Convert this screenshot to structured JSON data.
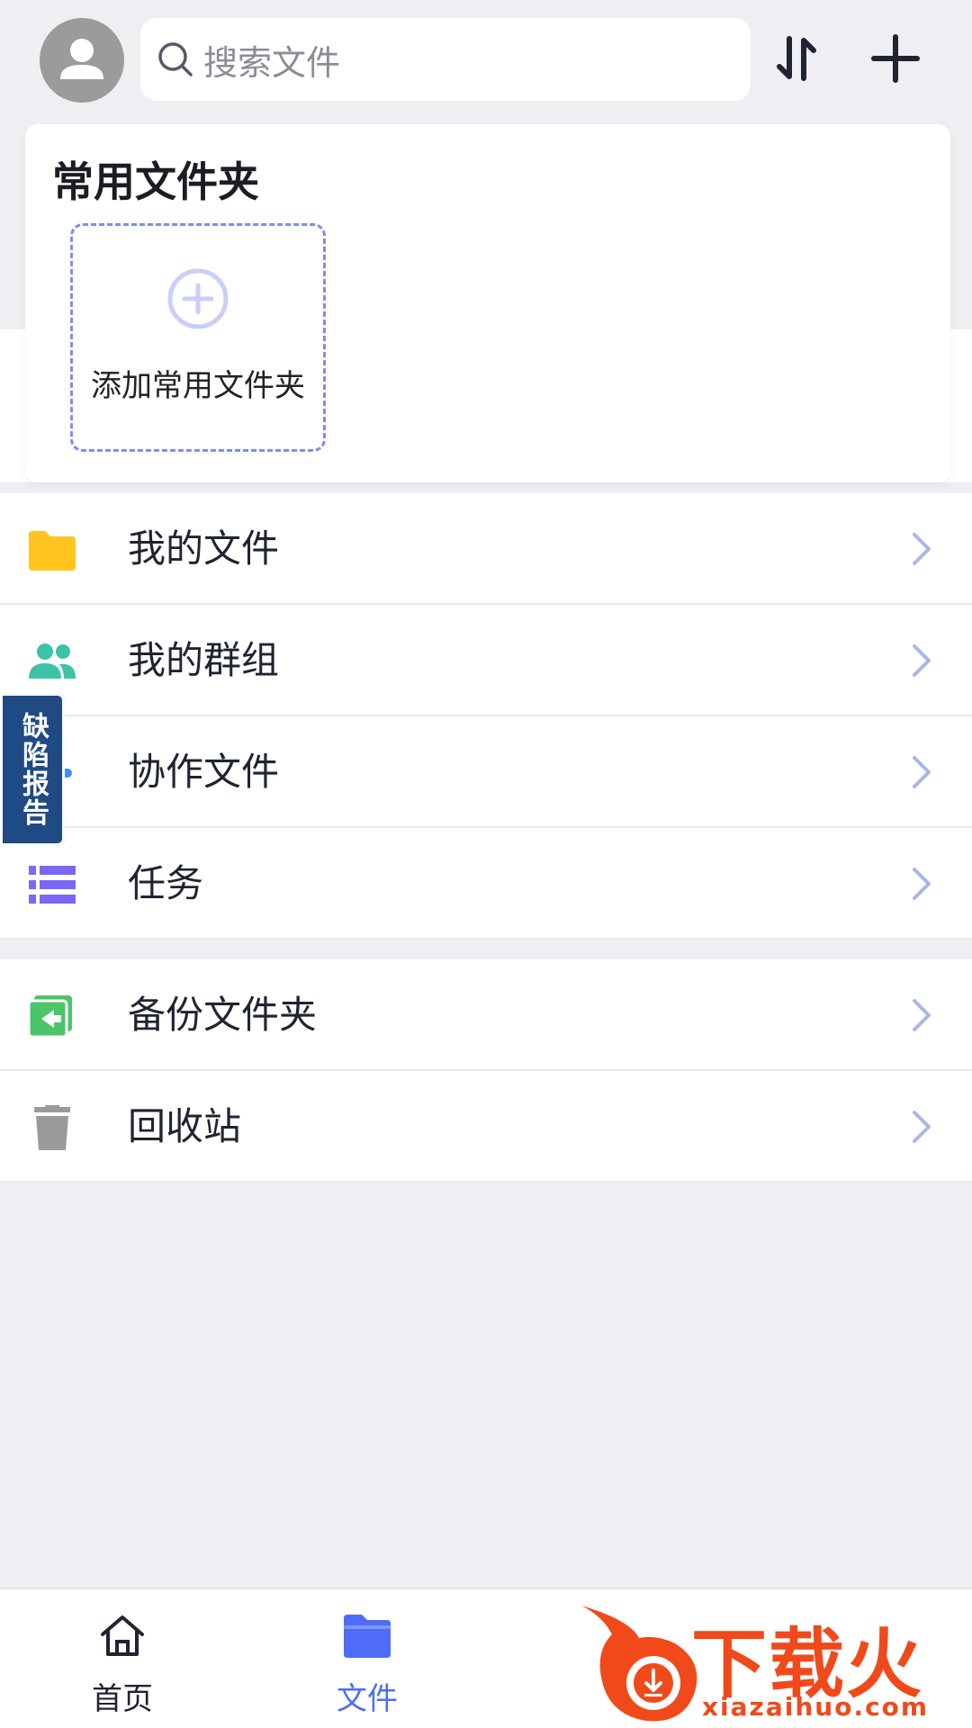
{
  "header": {
    "search_placeholder": "搜索文件"
  },
  "common_folders": {
    "title": "常用文件夹",
    "add_label": "添加常用文件夹"
  },
  "list_group_1": [
    {
      "label": "我的文件",
      "icon": "folder-icon",
      "color": "#ffc51e"
    },
    {
      "label": "我的群组",
      "icon": "group-icon",
      "color": "#3cc3a5"
    },
    {
      "label": "协作文件",
      "icon": "collab-icon",
      "color": "#3d8ff5"
    },
    {
      "label": "任务",
      "icon": "task-list-icon",
      "color": "#7868f5"
    }
  ],
  "list_group_2": [
    {
      "label": "备份文件夹",
      "icon": "backup-folder-icon",
      "color": "#4cc46a"
    },
    {
      "label": "回收站",
      "icon": "trash-icon",
      "color": "#9a9a9a"
    }
  ],
  "side_tab": {
    "label": "缺陷报告"
  },
  "bottom_nav": [
    {
      "label": "首页",
      "icon": "home-icon",
      "active": false
    },
    {
      "label": "文件",
      "icon": "files-icon",
      "active": true
    }
  ],
  "watermark": {
    "brand": "下载火",
    "url": "xiazaihuo.com"
  },
  "colors": {
    "accent": "#4f6cf7",
    "background": "#eeeef3",
    "side_tab": "#1f4a84",
    "watermark": "#f04a1b"
  }
}
